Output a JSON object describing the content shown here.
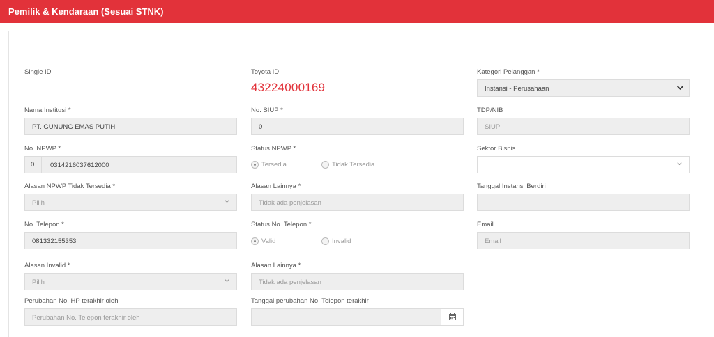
{
  "header": {
    "title": "Pemilik & Kendaraan (Sesuai STNK)"
  },
  "form": {
    "single_id": {
      "label": "Single ID"
    },
    "toyota_id": {
      "label": "Toyota ID",
      "value": "43224000169"
    },
    "kategori": {
      "label": "Kategori Pelanggan *",
      "value": "Instansi - Perusahaan"
    },
    "nama_institusi": {
      "label": "Nama Institusi *",
      "value": "PT. GUNUNG EMAS PUTIH"
    },
    "no_siup": {
      "label": "No. SIUP *",
      "value": "0"
    },
    "tdp_nib": {
      "label": "TDP/NIB",
      "placeholder": "SIUP"
    },
    "no_npwp": {
      "label": "No. NPWP *",
      "prefix": "0",
      "value": "0314216037612000"
    },
    "status_npwp": {
      "label": "Status NPWP *",
      "options": [
        "Tersedia",
        "Tidak Tersedia"
      ],
      "selected": "Tersedia"
    },
    "sektor_bisnis": {
      "label": "Sektor Bisnis",
      "value": ""
    },
    "alasan_npwp": {
      "label": "Alasan NPWP Tidak Tersedia *",
      "placeholder": "Pilih"
    },
    "alasan_lainnya_1": {
      "label": "Alasan Lainnya *",
      "placeholder": "Tidak ada penjelasan"
    },
    "tanggal_instansi": {
      "label": "Tanggal Instansi Berdiri",
      "value": ""
    },
    "no_telepon": {
      "label": "No. Telepon *",
      "value": "081332155353"
    },
    "status_telepon": {
      "label": "Status No. Telepon *",
      "options": [
        "Valid",
        "Invalid"
      ],
      "selected": "Valid"
    },
    "email": {
      "label": "Email",
      "placeholder": "Email"
    },
    "alasan_invalid": {
      "label": "Alasan Invalid *",
      "placeholder": "Pilih"
    },
    "alasan_lainnya_2": {
      "label": "Alasan Lainnya *",
      "placeholder": "Tidak ada penjelasan"
    },
    "perubahan_hp": {
      "label": "Perubahan No. HP terakhir oleh",
      "placeholder": "Perubahan No. Telepon terakhir oleh"
    },
    "tanggal_perubahan": {
      "label": "Tanggal perubahan No. Telepon terakhir",
      "value": ""
    }
  },
  "colors": {
    "header": "#e2323a",
    "field_bg": "#eeeeee",
    "accent_text": "#e2323a"
  },
  "icons": {
    "select": "chevron-down-icon",
    "date": "calendar-icon"
  }
}
